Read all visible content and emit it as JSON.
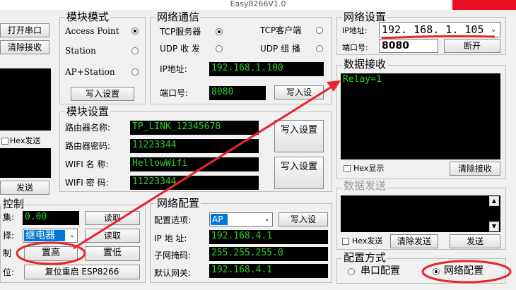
{
  "window": {
    "title": "Easy8266V1.0"
  },
  "left_panel": {
    "open_port": "打开串口",
    "clear_receive": "清除接收",
    "hex_send": "Hex发送",
    "send": "发送",
    "control_title": "控制",
    "collect_label": "集:",
    "collect_value": "0.00",
    "read1": "读取",
    "select_label": "择:",
    "select_value": "继电器",
    "read2": "读取",
    "control_label": "制",
    "set_high": "置高",
    "set_low": "置低",
    "reset_label": "位:",
    "reset_button": "复位重启  ESP8266"
  },
  "module_mode": {
    "title": "模块模式",
    "options": [
      "Access Point",
      "Station",
      "AP+Station"
    ],
    "selected": "Access Point",
    "write": "写入设置"
  },
  "network_comm": {
    "title": "网络通信",
    "tcp_server": "TCP服务器",
    "tcp_client": "TCP客户端",
    "udp_send": "UDP 收 发",
    "udp_group": "UDP 组 播",
    "ip_label": "IP地址:",
    "ip_value": "192.168.1.100",
    "port_label": "端口号:",
    "port_value": "8080",
    "write": "写入设"
  },
  "module_settings": {
    "title": "模块设置",
    "router_name_label": "路由器名称:",
    "router_name": "TP_LINK_12345678",
    "router_pwd_label": "路由器密码:",
    "router_pwd": "11223344",
    "wifi_name_label": "WIFI 名 称:",
    "wifi_name": "HellowWifi",
    "wifi_pwd_label": "WIFI 密 码:",
    "wifi_pwd": "11223344",
    "write1": "写入设置",
    "write2": "写入设置"
  },
  "network_config": {
    "title": "网络配置",
    "option_label": "配置选项:",
    "option_value": "AP",
    "write": "写入设",
    "ip_label": "IP 地 址:",
    "ip_value": "192.168.4.1",
    "mask_label": "子网掩码:",
    "mask_value": "255.255.255.0",
    "gateway_label": "默认网关:",
    "gateway_value": "192.168.4.1"
  },
  "network_settings": {
    "title": "网络设置",
    "ip_label": "IP地址:",
    "ip_value": "192. 168. 1. 105",
    "port_label": "端口号:",
    "port_value": "8080",
    "open": "断开"
  },
  "data_receive": {
    "title": "数据接收",
    "content": "Relay=1",
    "hex_display": "Hex显示",
    "clear": "清除接收"
  },
  "data_send": {
    "title": "数据发送",
    "hex_send": "Hex发送",
    "clear": "清除发送",
    "send": "发送"
  },
  "config_mode": {
    "title": "配置方式",
    "serial": "串口配置",
    "network": "网络配置",
    "selected": "网络配置"
  },
  "colors": {
    "lcd_text": "#2cd12c",
    "annotation": "#e8262b"
  }
}
